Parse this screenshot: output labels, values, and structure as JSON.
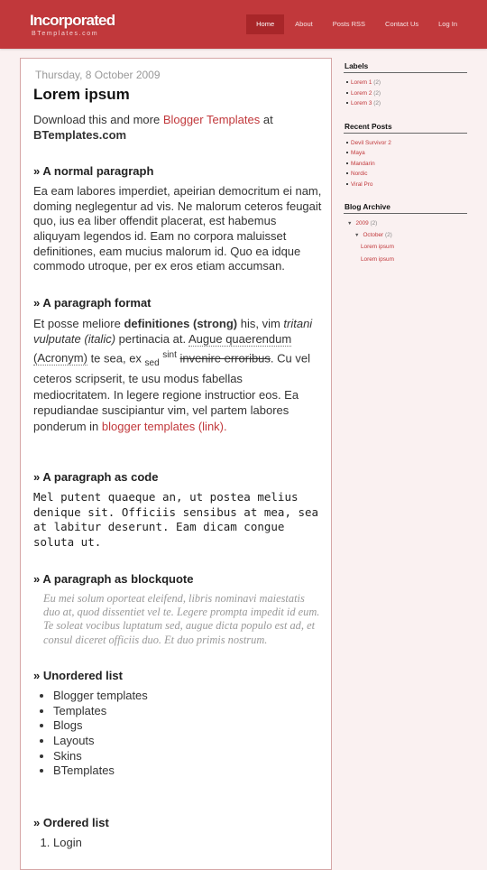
{
  "header": {
    "title": "Incorporated",
    "subtitle": "BTemplates.com",
    "nav": [
      "Home",
      "About",
      "Posts RSS",
      "Contact Us",
      "Log In"
    ],
    "active_nav": "Home"
  },
  "post": {
    "date": "Thursday, 8 October 2009",
    "title": "Lorem ipsum",
    "intro_pre": "Download this and more ",
    "intro_link": "Blogger Templates",
    "intro_mid": " at",
    "intro_bold": "BTemplates.com",
    "sections": {
      "normal": {
        "heading": "» A normal paragraph",
        "text": "Ea eam labores imperdiet, apeirian democritum ei nam, doming neglegentur ad vis. Ne malorum ceteros feugait quo, ius ea liber offendit placerat, est habemus aliquyam legendos id. Eam no corpora maluisset definitiones, eam mucius malorum id. Quo ea idque commodo utroque, per ex eros etiam accumsan."
      },
      "format": {
        "heading": "» A paragraph format",
        "t1": "Et posse meliore ",
        "strong": "definitiones (strong)",
        "t2": " his, vim ",
        "italic": "tritani vulputate (italic)",
        "t3": " pertinacia at. ",
        "abbr1": "Augue quaerendum",
        "t4": " ",
        "abbr2": "(Acronym)",
        "t5": " te sea, ex ",
        "sub": "sed",
        "t6": " ",
        "sup": "sint",
        "t7": " ",
        "strike": "invenire erroribus",
        "t8": ". Cu vel ceteros scripserit, te usu modus fabellas mediocritatem. In legere regione instructior eos. Ea repudiandae suscipiantur vim, vel partem labores ponderum in ",
        "link": "blogger templates (link)."
      },
      "code": {
        "heading": "» A paragraph as code",
        "text": "Mel putent quaeque an, ut postea melius denique sit. Officiis sensibus at mea, sea at labitur deserunt. Eam dicam congue soluta ut."
      },
      "blockquote": {
        "heading": "» A paragraph as blockquote",
        "text": "Eu mei solum oporteat eleifend, libris nominavi maiestatis duo at, quod dissentiet vel te. Legere prompta impedit id eum. Te soleat vocibus luptatum sed, augue dicta populo est ad, et consul diceret officiis duo. Et duo primis nostrum."
      },
      "unordered": {
        "heading": "» Unordered list",
        "items": [
          "Blogger templates",
          "Templates",
          "Blogs",
          "Layouts",
          "Skins",
          "BTemplates"
        ]
      },
      "ordered": {
        "heading": "» Ordered list",
        "items": [
          "Login"
        ]
      }
    }
  },
  "sidebar": {
    "labels": {
      "title": "Labels",
      "items": [
        {
          "name": "Lorem 1",
          "count": "(2)"
        },
        {
          "name": "Lorem 2",
          "count": "(2)"
        },
        {
          "name": "Lorem 3",
          "count": "(2)"
        }
      ]
    },
    "recent": {
      "title": "Recent Posts",
      "items": [
        "Devil Survivor 2",
        "Maya",
        "Mandarin",
        "Nordic",
        "Viral Pro"
      ]
    },
    "archive": {
      "title": "Blog Archive",
      "year": "2009",
      "year_count": "(2)",
      "month": "October",
      "month_count": "(2)",
      "posts": [
        "Lorem ipsum",
        "Lorem ipsum"
      ],
      "expanded_icon": "▼"
    }
  }
}
